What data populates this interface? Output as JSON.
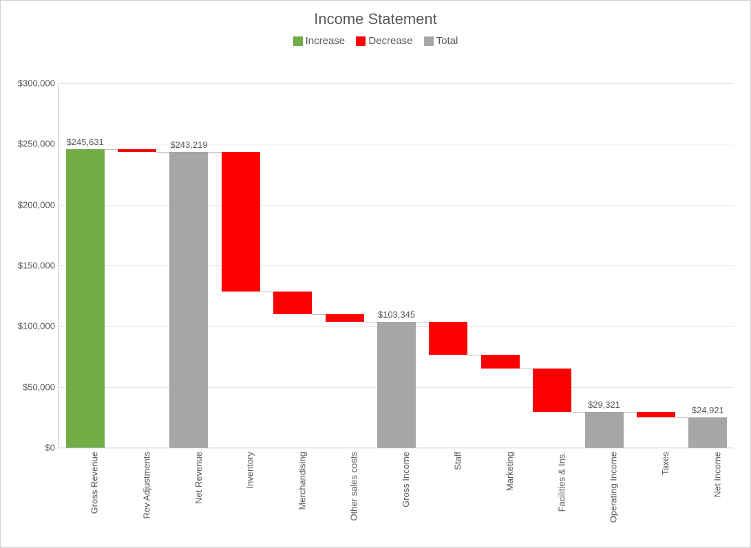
{
  "chart_data": {
    "type": "waterfall",
    "title": "Income Statement",
    "xlabel": "",
    "ylabel": "",
    "ylim": [
      0,
      300000
    ],
    "y_ticks": [
      "$0",
      "$50,000",
      "$100,000",
      "$150,000",
      "$200,000",
      "$250,000",
      "$300,000"
    ],
    "legend": {
      "increase": "Increase",
      "decrease": "Decrease",
      "total": "Total"
    },
    "colors": {
      "increase": "#70ad47",
      "decrease": "#ff0000",
      "total": "#a6a6a6"
    },
    "items": [
      {
        "name": "Gross Revenue",
        "type": "increase",
        "delta": 245631,
        "base": 0,
        "end": 245631,
        "label": "$245,631"
      },
      {
        "name": "Rev Adjustments",
        "type": "decrease",
        "delta": -2412,
        "base": 245631,
        "end": 243219,
        "label": ""
      },
      {
        "name": "Net Revenue",
        "type": "total",
        "delta": 243219,
        "base": 0,
        "end": 243219,
        "label": "$243,219"
      },
      {
        "name": "Inventory",
        "type": "decrease",
        "delta": -114899,
        "base": 243219,
        "end": 128320,
        "label": ""
      },
      {
        "name": "Merchandising",
        "type": "decrease",
        "delta": -18700,
        "base": 128320,
        "end": 109620,
        "label": ""
      },
      {
        "name": "Other sales costs",
        "type": "decrease",
        "delta": -6275,
        "base": 109620,
        "end": 103345,
        "label": ""
      },
      {
        "name": "Gross Income",
        "type": "total",
        "delta": 103345,
        "base": 0,
        "end": 103345,
        "label": "$103,345"
      },
      {
        "name": "Staff",
        "type": "decrease",
        "delta": -26790,
        "base": 103345,
        "end": 76555,
        "label": ""
      },
      {
        "name": "Marketing",
        "type": "decrease",
        "delta": -11234,
        "base": 76555,
        "end": 65321,
        "label": ""
      },
      {
        "name": "Facilities & Ins.",
        "type": "decrease",
        "delta": -36000,
        "base": 65321,
        "end": 29321,
        "label": ""
      },
      {
        "name": "Operating Income",
        "type": "total",
        "delta": 29321,
        "base": 0,
        "end": 29321,
        "label": "$29,321"
      },
      {
        "name": "Taxes",
        "type": "decrease",
        "delta": -4400,
        "base": 29321,
        "end": 24921,
        "label": ""
      },
      {
        "name": "Net Income",
        "type": "total",
        "delta": 24921,
        "base": 0,
        "end": 24921,
        "label": "$24,921"
      }
    ]
  }
}
